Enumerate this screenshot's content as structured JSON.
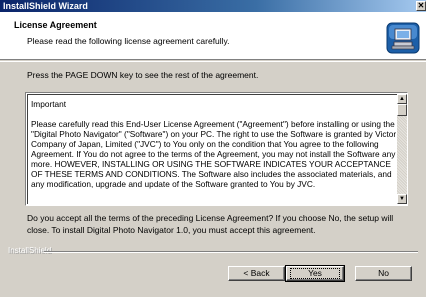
{
  "window": {
    "title": "InstallShield Wizard",
    "close_glyph": "✕"
  },
  "header": {
    "title": "License Agreement",
    "subtitle": "Please read the following license agreement carefully.",
    "icon": "installer-computer-icon"
  },
  "instructions": "Press the PAGE DOWN key to see the rest of the agreement.",
  "license": {
    "text": "Important\n\nPlease carefully read this End-User License Agreement (\"Agreement\") before installing or using the \"Digital Photo Navigator\" (\"Software\") on your PC.  The right to use the Software is granted by Victor Company of Japan, Limited (\"JVC\") to You only on the condition that You agree to the following Agreement. If You do not agree to the terms of the Agreement, you may not install the Software any more.  HOWEVER, INSTALLING OR USING THE SOFTWARE INDICATES YOUR ACCEPTANCE OF THESE TERMS AND CONDITIONS.  The Software also includes the associated materials, and any modification, upgrade and update of the Software granted to You by JVC."
  },
  "scrollbar": {
    "up_glyph": "▲",
    "down_glyph": "▼"
  },
  "question": "Do you accept all the terms of the preceding License Agreement?  If you choose No,  the setup will close.  To install Digital Photo Navigator 1.0, you must accept this agreement.",
  "footer": {
    "brand": "InstallShield"
  },
  "buttons": {
    "back": "< Back",
    "yes": "Yes",
    "no": "No"
  }
}
